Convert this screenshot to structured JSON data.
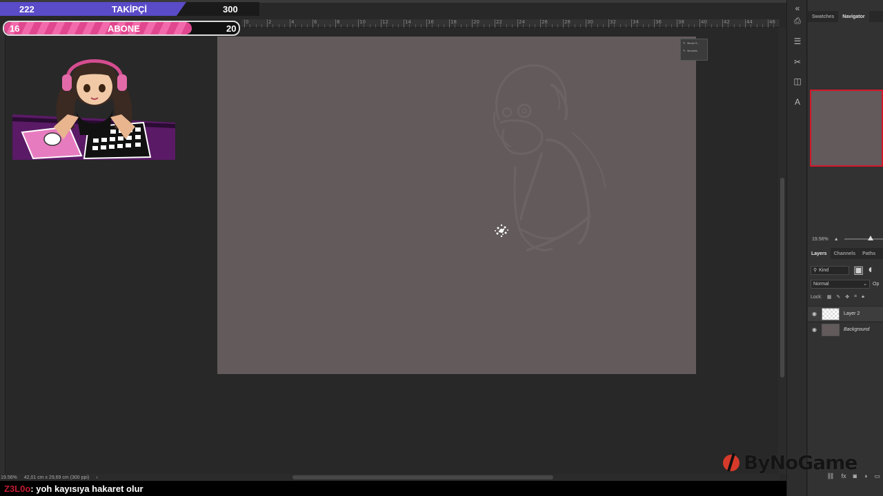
{
  "overlay": {
    "followers": {
      "current": "222",
      "label": "TAKİPÇİ",
      "goal": "300",
      "progress": 0.74
    },
    "subscribers": {
      "current": "16",
      "label": "ABONE",
      "goal": "20",
      "progress": 0.8
    }
  },
  "ruler": {
    "numbers": [
      "0",
      "2",
      "4",
      "6",
      "8",
      "10",
      "12",
      "14",
      "16",
      "18",
      "20",
      "22",
      "24",
      "26",
      "28",
      "30",
      "32",
      "34",
      "36",
      "38",
      "40",
      "42",
      "44",
      "46"
    ]
  },
  "canvas": {
    "background": "#625a5b"
  },
  "mini_panel": {
    "items": [
      "Brush S...",
      "Brushes"
    ]
  },
  "status": {
    "zoom": "19.56%",
    "doc_size": "42,01 cm x 29,69 cm (300 ppi)"
  },
  "chat": {
    "user": "Z3L0o",
    "message": " : yoh kayısıya hakaret olur"
  },
  "panel": {
    "tabs": [
      "Swatches",
      "Navigator"
    ],
    "zoom": "19.56%",
    "layer_tabs": [
      "Layers",
      "Channels",
      "Paths"
    ],
    "kind": "Kind",
    "blend_mode": "Normal",
    "opacity_label": "Op",
    "lock_label": "Lock:",
    "layers": [
      {
        "name": "Layer 2",
        "selected": true
      },
      {
        "name": "Background",
        "selected": false
      }
    ]
  },
  "watermark": {
    "text": "ByNoGame"
  },
  "colors": {
    "accent_red": "#d3162a",
    "follower_bar": "#5a4bc8",
    "sub_bar": "#e0478f"
  }
}
